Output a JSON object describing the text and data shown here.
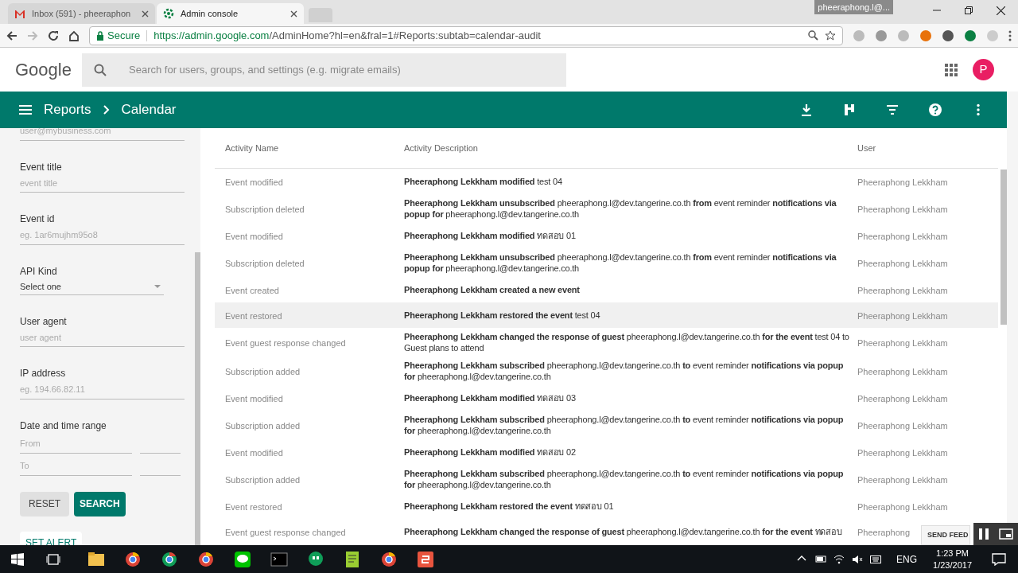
{
  "browser": {
    "tabs": [
      {
        "title": "Inbox (591) - pheeraphon",
        "kind": "mail",
        "selected": false
      },
      {
        "title": "Admin console",
        "kind": "admin",
        "selected": true
      }
    ],
    "profile": "pheeraphong.l@...",
    "secure_label": "Secure",
    "url_host": "https://admin.google.com",
    "url_path": "/AdminHome?hl=en&fral=1#Reports:subtab=calendar-audit"
  },
  "header": {
    "logo": "Google",
    "search_placeholder": "Search for users, groups, and settings (e.g. migrate emails)",
    "avatar_letter": "P"
  },
  "toolbar": {
    "breadcrumb": [
      "Reports",
      "Calendar"
    ]
  },
  "filters": [
    {
      "kind": "text",
      "placeholder": "user@mybusiness.com"
    },
    {
      "kind": "text",
      "label": "Event title",
      "placeholder": "event title"
    },
    {
      "kind": "text",
      "label": "Event id",
      "placeholder": "eg. 1ar6mujhm95o8"
    },
    {
      "kind": "select",
      "label": "API Kind",
      "value": "Select one"
    },
    {
      "kind": "text",
      "label": "User agent",
      "placeholder": "user agent"
    },
    {
      "kind": "text",
      "label": "IP address",
      "placeholder": "eg. 194.66.82.11"
    },
    {
      "kind": "range",
      "label": "Date and time range",
      "fields": [
        {
          "placeholder": "From"
        },
        {
          "placeholder": "To"
        }
      ]
    }
  ],
  "buttons": {
    "reset": "RESET",
    "search": "SEARCH",
    "set_alert": "SET ALERT"
  },
  "table": {
    "columns": [
      "Activity Name",
      "Activity Description",
      "User"
    ],
    "rows": [
      {
        "name": "Event modified",
        "description": "**Pheeraphong Lekkham modified** test 04",
        "user": "Pheeraphong Lekkham",
        "selected": false
      },
      {
        "name": "Subscription deleted",
        "description": "**Pheeraphong Lekkham unsubscribed** pheeraphong.l@dev.tangerine.co.th **from** event reminder **notifications via popup for** pheeraphong.l@dev.tangerine.co.th",
        "user": "Pheeraphong Lekkham",
        "selected": false
      },
      {
        "name": "Event modified",
        "description": "**Pheeraphong Lekkham modified** ทดสอบ 01",
        "user": "Pheeraphong Lekkham",
        "selected": false
      },
      {
        "name": "Subscription deleted",
        "description": "**Pheeraphong Lekkham unsubscribed** pheeraphong.l@dev.tangerine.co.th **from** event reminder **notifications via popup for** pheeraphong.l@dev.tangerine.co.th",
        "user": "Pheeraphong Lekkham",
        "selected": false
      },
      {
        "name": "Event created",
        "description": "**Pheeraphong Lekkham created a new event**",
        "user": "Pheeraphong Lekkham",
        "selected": false
      },
      {
        "name": "Event restored",
        "description": "**Pheeraphong Lekkham restored the event** test 04",
        "user": "Pheeraphong Lekkham",
        "selected": true
      },
      {
        "name": "Event guest response changed",
        "description": "**Pheeraphong Lekkham changed the response of guest** pheeraphong.l@dev.tangerine.co.th **for the event** test 04 to Guest plans to attend",
        "user": "Pheeraphong Lekkham",
        "selected": false
      },
      {
        "name": "Subscription added",
        "description": "**Pheeraphong Lekkham subscribed** pheeraphong.l@dev.tangerine.co.th **to** event reminder **notifications via popup for** pheeraphong.l@dev.tangerine.co.th",
        "user": "Pheeraphong Lekkham",
        "selected": false
      },
      {
        "name": "Event modified",
        "description": "**Pheeraphong Lekkham modified** ทดสอบ 03",
        "user": "Pheeraphong Lekkham",
        "selected": false
      },
      {
        "name": "Subscription added",
        "description": "**Pheeraphong Lekkham subscribed** pheeraphong.l@dev.tangerine.co.th **to** event reminder **notifications via popup for** pheeraphong.l@dev.tangerine.co.th",
        "user": "Pheeraphong Lekkham",
        "selected": false
      },
      {
        "name": "Event modified",
        "description": "**Pheeraphong Lekkham modified** ทดสอบ 02",
        "user": "Pheeraphong Lekkham",
        "selected": false
      },
      {
        "name": "Subscription added",
        "description": "**Pheeraphong Lekkham subscribed** pheeraphong.l@dev.tangerine.co.th **to** event reminder **notifications via popup for** pheeraphong.l@dev.tangerine.co.th",
        "user": "Pheeraphong Lekkham",
        "selected": false
      },
      {
        "name": "Event restored",
        "description": "**Pheeraphong Lekkham restored the event** ทดสอบ 01",
        "user": "Pheeraphong Lekkham",
        "selected": false
      },
      {
        "name": "Event guest response changed",
        "description": "**Pheeraphong Lekkham changed the response of guest** pheeraphong.l@dev.tangerine.co.th **for the event** ทดสอบ",
        "user": "Pheeraphong",
        "selected": false
      }
    ]
  },
  "send_feedback": "SEND FEED",
  "taskbar": {
    "language": "ENG",
    "time": "1:23 PM",
    "date": "1/23/2017"
  }
}
